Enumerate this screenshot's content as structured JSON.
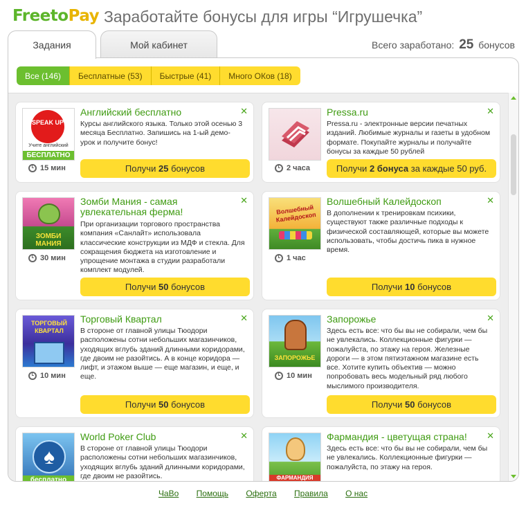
{
  "header": {
    "logo_free": "Freeto",
    "logo_pay": "Pay",
    "title": "Заработайте бонусы для игры “Игрушечка”"
  },
  "tabs": [
    {
      "label": "Задания",
      "active": true
    },
    {
      "label": "Мой кабинет",
      "active": false
    }
  ],
  "earned": {
    "prefix": "Всего заработано:",
    "value": "25",
    "suffix": "бонусов"
  },
  "filters": [
    {
      "label": "Все (146)",
      "active": true
    },
    {
      "label": "Бесплатные (53)",
      "active": false
    },
    {
      "label": "Быстрые (41)",
      "active": false
    },
    {
      "label": "Много ОКов (18)",
      "active": false
    }
  ],
  "offers": [
    {
      "title": "Английский бесплатно",
      "description": "Курсы английского языка. Только этой осенью 3 месяца Бесплатно. Запишись на 1-ый демо-урок и получите бонус!",
      "time": "15 мин",
      "free_badge": "БЕСПЛАТНО",
      "thumb_text": "SPEAK UP",
      "thumb_caption": "Учите английский",
      "cta_prefix": "Получи",
      "cta_amount": "25",
      "cta_suffix": "бонусов",
      "close": "✕"
    },
    {
      "title": "Pressa.ru",
      "description": "Pressa.ru - электронные версии печатных изданий. Любимые журналы и газеты в удобном формате. Покупайте журналы и получайте бонусы за каждые 50 рублей",
      "time": "2 часа",
      "cta_prefix": "Получи",
      "cta_amount": "2 бонуса",
      "cta_suffix": "за каждые 50 руб.",
      "close": "✕"
    },
    {
      "title": "Зомби Мания - самая увлекательная ферма!",
      "description": "При организации торгового пространства компания «Санлайт» использовала классические конструкции из МДФ и стекла. Для сокращения бюджета на изготовление и упрощение монтажа в студии разработали комплект модулей.",
      "time": "30 мин",
      "thumb_text": "ЗОМБИ МАНИЯ",
      "cta_prefix": "Получи",
      "cta_amount": "50",
      "cta_suffix": "бонусов",
      "close": "✕"
    },
    {
      "title": "Волшебный Калейдоскоп",
      "description": "В дополнении к тренировкам психики, существуют также различные подходы к физической составляющей, которые вы можете использовать, чтобы достичь пика в нужное время.",
      "time": "1 час",
      "thumb_text": "Волшебный Калейдоскоп",
      "cta_prefix": "Получи",
      "cta_amount": "10",
      "cta_suffix": "бонусов",
      "close": "✕"
    },
    {
      "title": "Торговый Квартал",
      "description": "В стороне от главной улицы Тюодори расположены сотни небольших магазинчиков, уходящих вглубь зданий длинными коридорами, где двоим не разойтись. А в конце коридора — лифт, и этажом выше — еще магазин, и еще, и еще.",
      "time": "10 мин",
      "thumb_text": "ТОРГОВЫЙ КВАРТАЛ",
      "cta_prefix": "Получи",
      "cta_amount": "50",
      "cta_suffix": "бонусов",
      "close": "✕"
    },
    {
      "title": "Запорожье",
      "description": "Здесь есть все: что бы вы не собирали, чем бы не увлекались. Коллекционные фигурки — пожалуйста, по этажу на героя. Железные дороги — в этом пятиэтажном магазине есть все. Хотите купить объектив — можно попробовать весь модельный ряд любого мыслимого производителя.",
      "time": "10 мин",
      "thumb_text": "ЗАПОРОЖЬЕ",
      "cta_prefix": "Получи",
      "cta_amount": "50",
      "cta_suffix": "бонусов",
      "close": "✕"
    },
    {
      "title": "World Poker Club",
      "description": "В стороне от главной улицы Тюодори расположены сотни небольших магазинчиков, уходящих вглубь зданий длинными коридорами, где двоим не разойтись.",
      "free_badge": "бесплатно",
      "close": "✕"
    },
    {
      "title": "Фармандия - цветущая страна!",
      "description": "Здесь есть все: что бы вы не собирали, чем бы не увлекались. Коллекционные фигурки — пожалуйста, по этажу на героя.",
      "thumb_text": "ФАРМАНДИЯ",
      "close": "✕"
    }
  ],
  "footer": {
    "links": [
      "ЧаВо",
      "Помощь",
      "Оферта",
      "Правила",
      "О нас"
    ]
  },
  "colors": {
    "brand_green": "#6cbf2f",
    "brand_yellow": "#ffdc2e",
    "title_green": "#3f9b12"
  }
}
